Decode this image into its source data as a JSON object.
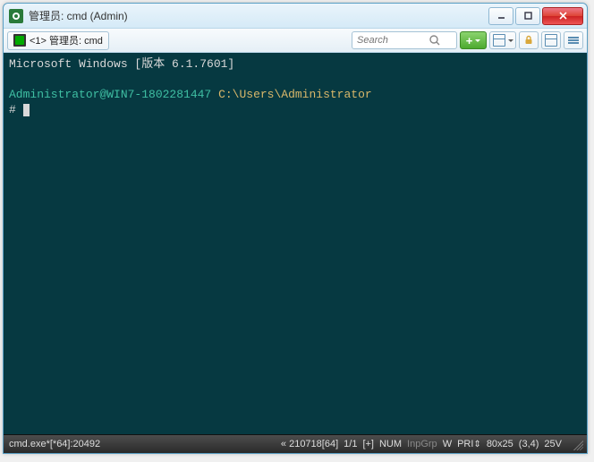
{
  "window": {
    "title": "管理员: cmd (Admin)"
  },
  "toolbar": {
    "tab": {
      "label": "<1> 管理员: cmd"
    },
    "search_placeholder": "Search"
  },
  "terminal": {
    "line1": "Microsoft Windows [版本 6.1.7601]",
    "user_host": "Administrator@WIN7-1802281447",
    "cwd": "C:\\Users\\Administrator",
    "prompt_symbol": "# "
  },
  "statusbar": {
    "process": "cmd.exe*[*64]:20492",
    "scroll": "« 210718[64]",
    "lines": "1/1",
    "insert_indicator": "[+]",
    "num_label": "NUM",
    "inpgrp_label": "InpGrp",
    "wrap_label": "W",
    "pri_label": "PRI",
    "size": "80x25",
    "cursor_pos": "(3,4)",
    "font_size": "25V"
  }
}
